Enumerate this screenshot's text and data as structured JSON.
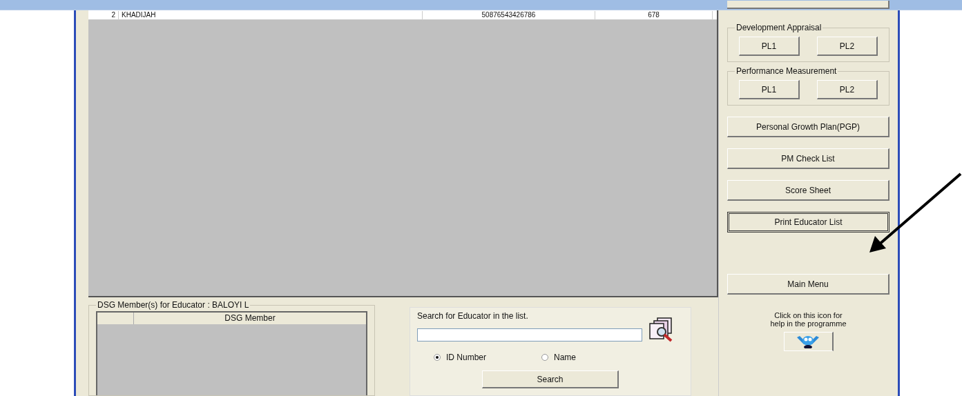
{
  "table": {
    "rows": [
      {
        "cells": [
          "2",
          "KHADIJAH",
          "50876543426786",
          "678"
        ]
      }
    ]
  },
  "dsg_group": {
    "title": "DSG Member(s) for Educator : BALOYI L",
    "columns": [
      "DSG Member"
    ]
  },
  "search_group": {
    "label": "Search for Educator in the list.",
    "radios": [
      {
        "label": "ID Number",
        "selected": true
      },
      {
        "label": "Name",
        "selected": false
      }
    ],
    "button": "Search"
  },
  "side_panel": {
    "groups": [
      {
        "title": "Development Appraisal",
        "buttons": [
          "PL1",
          "PL2"
        ]
      },
      {
        "title": "Performance Measurement",
        "buttons": [
          "PL1",
          "PL2"
        ]
      }
    ],
    "buttons": [
      {
        "label": "Personal Growth Plan(PGP)",
        "focused": false
      },
      {
        "label": "PM Check List",
        "focused": false
      },
      {
        "label": "Score Sheet",
        "focused": false
      },
      {
        "label": "Print Educator List",
        "focused": true
      }
    ],
    "main_menu": "Main Menu",
    "help_text": "Click on this icon for help in the programme"
  }
}
